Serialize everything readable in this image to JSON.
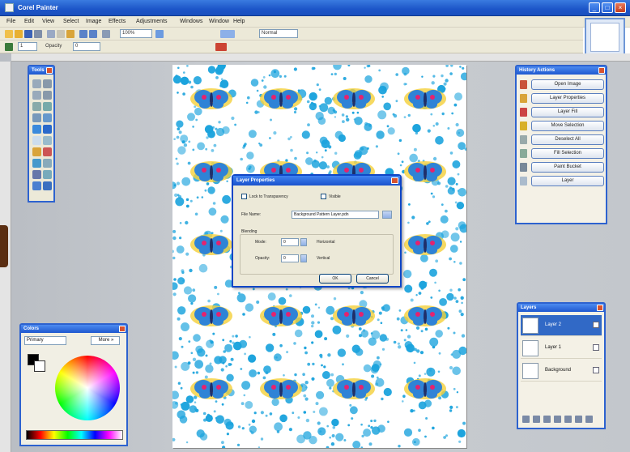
{
  "window": {
    "title": "Corel Painter",
    "min_label": "_",
    "max_label": "□",
    "close_label": "×"
  },
  "menu": [
    "File",
    "Edit",
    "View",
    "Select",
    "Image",
    "Effects",
    "Adjustments",
    "Windows",
    "Window",
    "Help"
  ],
  "toolbar": {
    "zoom_value": "100%",
    "brush_size": "1",
    "opacity_label": "Opacity",
    "blend_value": "Normal",
    "tolerance_value": "0"
  },
  "palettes": {
    "tools_title": "Tools",
    "colors_title": "Colors",
    "colors_mode": "Primary",
    "colors_more": "More »",
    "history_title": "History Actions",
    "history_items": [
      "Open Image",
      "Layer Properties",
      "Layer Fill",
      "Move Selection",
      "Deselect All",
      "Fill Selection",
      "Paint Bucket",
      "Layer"
    ],
    "layers_title": "Layers",
    "layers": [
      "Layer 2",
      "Layer 1",
      "Background"
    ]
  },
  "dialog": {
    "title": "Layer Properties",
    "checkbox1_label": "Lock to Transparency",
    "checkbox2_label": "Visible",
    "name_label": "File Name:",
    "name_value": "Background Pattern Layer.pdn",
    "group_label": "Blending",
    "mode_label": "Mode:",
    "mode_value": "0",
    "opacity_label": "Opacity:",
    "opacity_value": "0",
    "check_a": "Horizontal",
    "check_b": "Vertical",
    "ok_label": "OK",
    "cancel_label": "Cancel"
  },
  "colors": {
    "accent": "#2d62cf",
    "pattern_dot": "#1ba3dd",
    "butterfly_wing": "#2f83d6",
    "butterfly_glow": "#f4cf3a",
    "butterfly_body": "#e3236f"
  },
  "icons": [
    "app-icon",
    "new-icon",
    "open-icon",
    "save-icon",
    "print-icon",
    "cut-icon",
    "copy-icon",
    "paste-icon",
    "undo-icon",
    "redo-icon",
    "crop-icon"
  ]
}
